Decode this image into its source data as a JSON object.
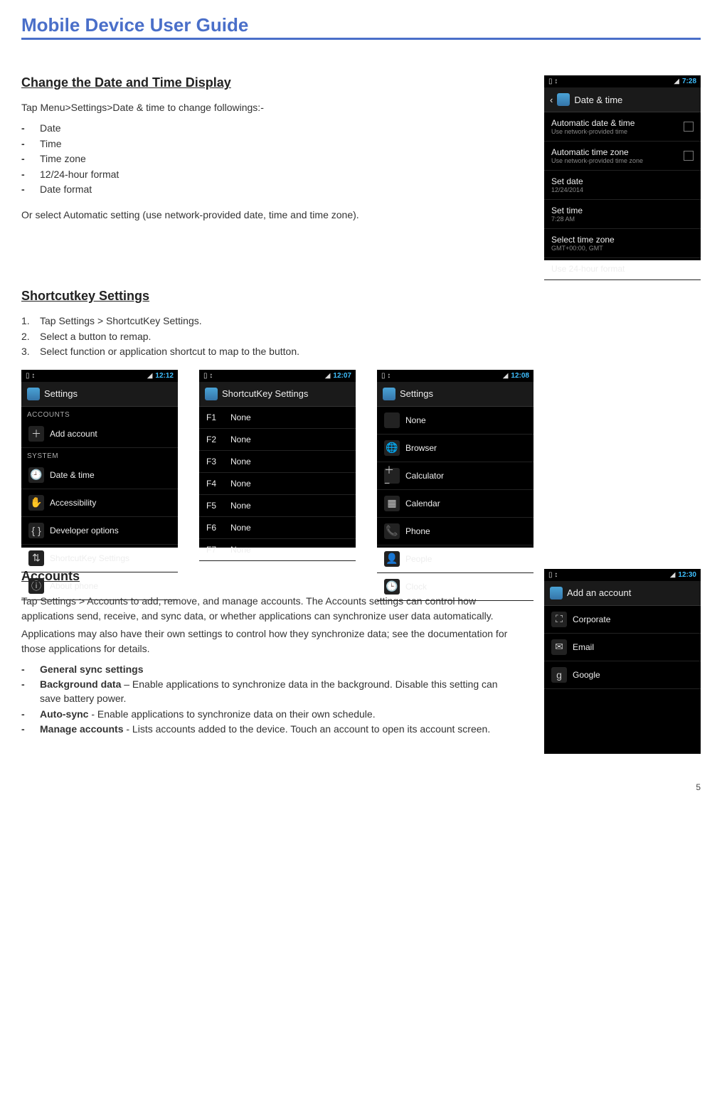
{
  "page_title": "Mobile Device User Guide",
  "page_number": "5",
  "s1": {
    "heading": "Change the Date and Time Display",
    "intro": "Tap Menu>Settings>Date & time to change followings:-",
    "items": [
      "Date",
      "Time",
      "Time zone",
      "12/24-hour format",
      "Date format"
    ],
    "outro": "Or select Automatic setting (use network-provided date, time and time zone).",
    "shot": {
      "time": "7:28",
      "title": "Date & time",
      "rows": [
        {
          "label": "Automatic date & time",
          "sub": "Use network-provided time",
          "chk": true
        },
        {
          "label": "Automatic time zone",
          "sub": "Use network-provided time zone",
          "chk": true
        },
        {
          "label": "Set date",
          "sub": "12/24/2014"
        },
        {
          "label": "Set time",
          "sub": "7:28 AM"
        },
        {
          "label": "Select time zone",
          "sub": "GMT+00:00, GMT"
        },
        {
          "label": "Use 24-hour format",
          "sub": ""
        }
      ]
    }
  },
  "s2": {
    "heading": "Shortcutkey Settings",
    "steps": [
      "Tap Settings > ShortcutKey Settings.",
      "Select a button to remap.",
      "Select function or application shortcut to map to the button."
    ],
    "shotA": {
      "time": "12:12",
      "title": "Settings",
      "sections": [
        {
          "label": "ACCOUNTS",
          "rows": [
            {
              "ico": "＋",
              "label": "Add account"
            }
          ]
        },
        {
          "label": "SYSTEM",
          "rows": [
            {
              "ico": "🕘",
              "label": "Date & time"
            },
            {
              "ico": "✋",
              "label": "Accessibility"
            },
            {
              "ico": "{ }",
              "label": "Developer options"
            },
            {
              "ico": "⇅",
              "label": "ShortcutKey Settings"
            },
            {
              "ico": "ⓘ",
              "label": "About phone"
            }
          ]
        }
      ]
    },
    "shotB": {
      "time": "12:07",
      "title": "ShortcutKey Settings",
      "rows": [
        {
          "key": "F1",
          "label": "None"
        },
        {
          "key": "F2",
          "label": "None"
        },
        {
          "key": "F3",
          "label": "None"
        },
        {
          "key": "F4",
          "label": "None"
        },
        {
          "key": "F5",
          "label": "None"
        },
        {
          "key": "F6",
          "label": "None"
        },
        {
          "key": "F7",
          "label": "None"
        }
      ]
    },
    "shotC": {
      "time": "12:08",
      "title": "Settings",
      "rows": [
        {
          "ico": "",
          "label": "None"
        },
        {
          "ico": "🌐",
          "label": "Browser"
        },
        {
          "ico": "＋−",
          "label": "Calculator"
        },
        {
          "ico": "▦",
          "label": "Calendar"
        },
        {
          "ico": "📞",
          "label": "Phone"
        },
        {
          "ico": "👤",
          "label": "People"
        },
        {
          "ico": "🕒",
          "label": "Clock"
        }
      ]
    }
  },
  "s3": {
    "heading": "Accounts",
    "p1": "Tap Settings > Accounts to add, remove, and manage accounts. The Accounts settings can control how applications send, receive, and sync data, or whether applications can synchronize user data automatically.",
    "p2": "Applications may also have their own settings to control how they synchronize data; see the documentation for those applications for details.",
    "items": [
      {
        "bold": "General sync settings",
        "rest": ""
      },
      {
        "bold": "Background data",
        "rest": " – Enable applications to synchronize data in the background. Disable this setting can save battery power."
      },
      {
        "bold": "Auto-sync",
        "rest": " - Enable applications to synchronize data on their own schedule."
      },
      {
        "bold": "Manage accounts",
        "rest": " - Lists accounts added to the device. Touch an account to open its account screen."
      }
    ],
    "shot": {
      "time": "12:30",
      "title": "Add an account",
      "rows": [
        {
          "ico": "⛶",
          "label": "Corporate"
        },
        {
          "ico": "✉",
          "label": "Email"
        },
        {
          "ico": "g",
          "label": "Google"
        }
      ]
    }
  }
}
